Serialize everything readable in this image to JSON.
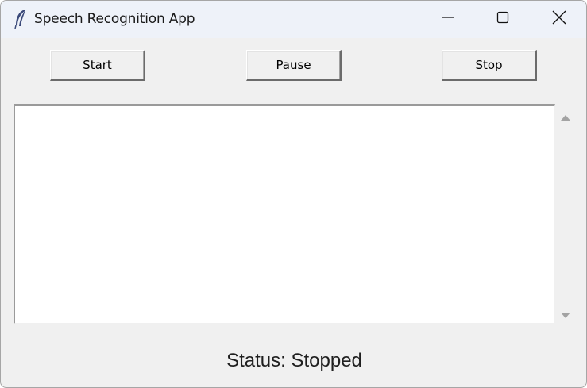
{
  "window": {
    "title": "Speech Recognition App",
    "app_icon": "feather-icon"
  },
  "controls": {
    "start_label": "Start",
    "pause_label": "Pause",
    "stop_label": "Stop"
  },
  "transcript": {
    "value": ""
  },
  "status": {
    "text": "Status: Stopped"
  },
  "colors": {
    "window_bg": "#f0f0f0",
    "titlebar_bg": "#eef2f9",
    "text_bg": "#ffffff"
  }
}
